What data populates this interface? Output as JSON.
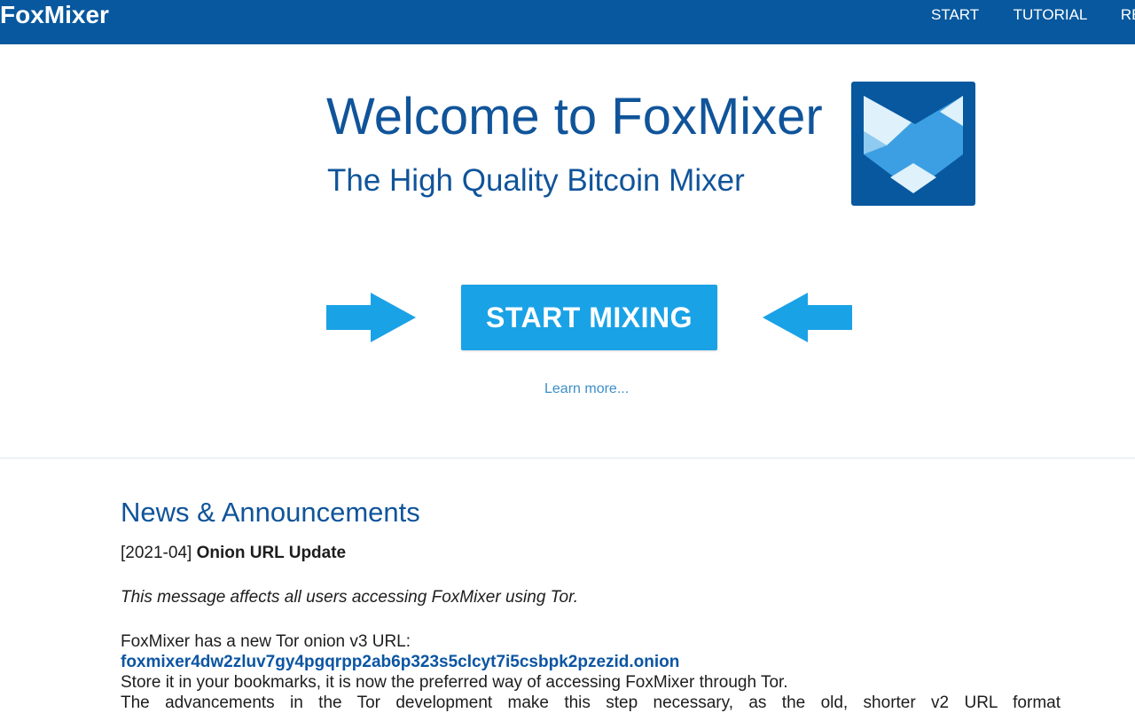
{
  "nav": {
    "brand": "FoxMixer",
    "links": [
      "START",
      "TUTORIAL",
      "REV"
    ]
  },
  "hero": {
    "title": "Welcome to FoxMixer",
    "subtitle": "The High Quality Bitcoin Mixer",
    "cta_label": "START MIXING",
    "learn_more": "Learn more..."
  },
  "news": {
    "heading": "News & Announcements",
    "date": "[2021-04]",
    "title": "Onion URL Update",
    "intro": "This message affects all users accessing FoxMixer using Tor.",
    "line1": "FoxMixer has a new Tor onion v3 URL:",
    "onion_url": "foxmixer4dw2zluv7gy4pgqrpp2ab6p323s5clcyt7i5csbpk2pzezid.onion",
    "line2": "Store it in your bookmarks, it is now the preferred way of accessing FoxMixer through Tor.",
    "line3": "The advancements in the Tor development make this step necessary, as the old, shorter v2 URL format"
  },
  "colors": {
    "nav_bg": "#07589e",
    "heading_blue": "#10549a",
    "accent_blue": "#1aa2e6",
    "link_blue": "#0b55a2"
  }
}
